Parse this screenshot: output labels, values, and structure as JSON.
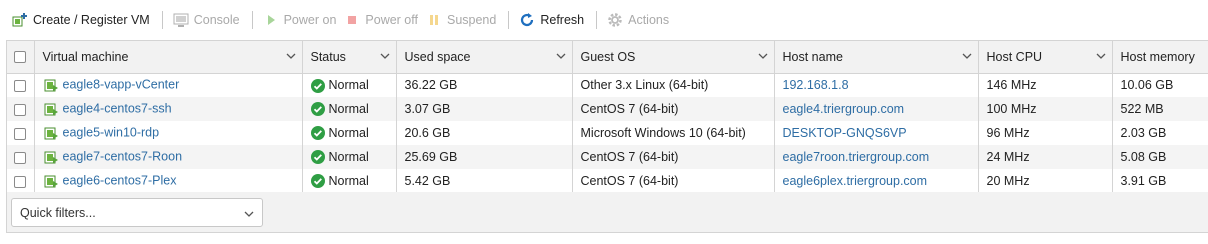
{
  "toolbar": {
    "create_label": "Create / Register VM",
    "console_label": "Console",
    "power_on_label": "Power on",
    "power_off_label": "Power off",
    "suspend_label": "Suspend",
    "refresh_label": "Refresh",
    "actions_label": "Actions"
  },
  "columns": {
    "vm": "Virtual machine",
    "status": "Status",
    "used": "Used space",
    "os": "Guest OS",
    "host": "Host name",
    "cpu": "Host CPU",
    "mem": "Host memory"
  },
  "rows": [
    {
      "vm": "eagle8-vapp-vCenter",
      "status": "Normal",
      "used": "36.22 GB",
      "os": "Other 3.x Linux (64-bit)",
      "host": "192.168.1.8",
      "cpu": "146 MHz",
      "mem": "10.06 GB"
    },
    {
      "vm": "eagle4-centos7-ssh",
      "status": "Normal",
      "used": "3.07 GB",
      "os": "CentOS 7 (64-bit)",
      "host": "eagle4.triergroup.com",
      "cpu": "100 MHz",
      "mem": "522 MB"
    },
    {
      "vm": "eagle5-win10-rdp",
      "status": "Normal",
      "used": "20.6 GB",
      "os": "Microsoft Windows 10 (64-bit)",
      "host": "DESKTOP-GNQS6VP",
      "cpu": "96 MHz",
      "mem": "2.03 GB"
    },
    {
      "vm": "eagle7-centos7-Roon",
      "status": "Normal",
      "used": "25.69 GB",
      "os": "CentOS 7 (64-bit)",
      "host": "eagle7roon.triergroup.com",
      "cpu": "24 MHz",
      "mem": "5.08 GB"
    },
    {
      "vm": "eagle6-centos7-Plex",
      "status": "Normal",
      "used": "5.42 GB",
      "os": "CentOS 7 (64-bit)",
      "host": "eagle6plex.triergroup.com",
      "cpu": "20 MHz",
      "mem": "3.91 GB"
    }
  ],
  "quick_filters": {
    "placeholder": "Quick filters..."
  },
  "colors": {
    "link": "#2e6da4",
    "status_ok": "#2f9e44",
    "vm_icon": "#58a53b",
    "refresh": "#1f6fbf"
  }
}
